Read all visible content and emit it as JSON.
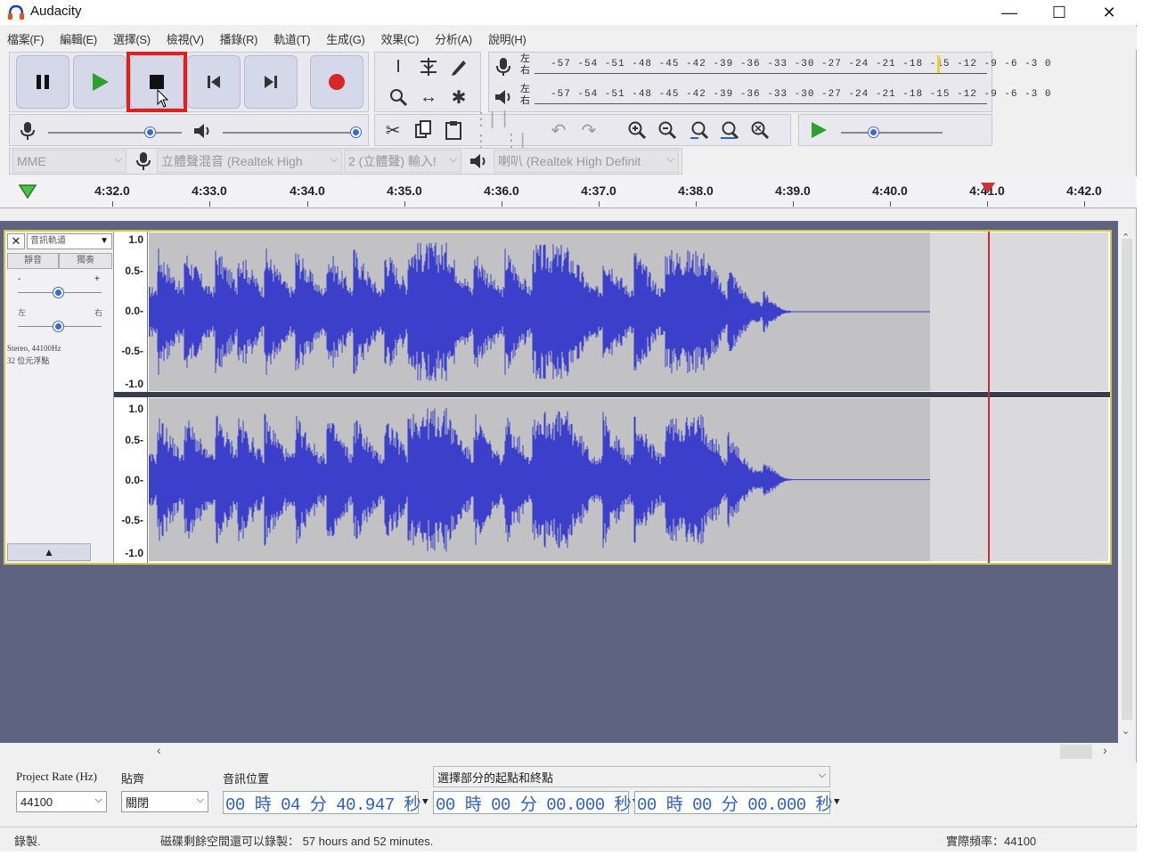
{
  "window": {
    "title": "Audacity",
    "minimize": "—",
    "maximize": "☐",
    "close": "✕"
  },
  "menu": [
    "檔案(F)",
    "編輯(E)",
    "選擇(S)",
    "檢視(V)",
    "播錄(R)",
    "軌道(T)",
    "生成(G)",
    "效果(C)",
    "分析(A)",
    "說明(H)"
  ],
  "meters": {
    "record_lr": "左右",
    "play_lr": "左右",
    "scale": "-57 -54 -51 -48 -45 -42 -39 -36 -33 -30 -27 -24 -21 -18 -15 -12 -9 -6 -3 0"
  },
  "devices": {
    "host": "MME",
    "input_device": "立體聲混音 (Realtek High",
    "channels": "2 (立體聲) 輸入!",
    "output_device": "喇叭 (Realtek High Definit"
  },
  "ruler": {
    "ticks": [
      "4:32.0",
      "4:33.0",
      "4:34.0",
      "4:35.0",
      "4:36.0",
      "4:37.0",
      "4:38.0",
      "4:39.0",
      "4:40.0",
      "4:41.0",
      "4:42.0"
    ]
  },
  "track": {
    "name": "音訊軌道",
    "mute": "靜音",
    "solo": "獨奏",
    "gain_minus": "-",
    "gain_plus": "+",
    "pan_left": "左",
    "pan_right": "右",
    "info_line1": "Stereo, 44100Hz",
    "info_line2": "32 位元浮點",
    "scale": [
      "1.0",
      "0.5-",
      "0.0-",
      "-0.5-",
      "-1.0"
    ]
  },
  "selection": {
    "rate_label": "Project Rate (Hz)",
    "rate_value": "44100",
    "snap_label": "貼齊",
    "snap_value": "關閉",
    "audio_pos_label": "音訊位置",
    "audio_pos_value": "00 時 04 分 40.947 秒",
    "sel_label": "選擇部分的起點和終點",
    "sel_start": "00 時 00 分 00.000 秒",
    "sel_end": "00 時 00 分 00.000 秒"
  },
  "status": {
    "state": "錄製.",
    "disk": "磁碟剩餘空間還可以錄製： 57 hours and 52 minutes.",
    "rate": "實際頻率：44100"
  },
  "colors": {
    "waveform": "#3b3fc9",
    "highlight_box": "#e02020",
    "track_border": "#d4c542",
    "playhead": "#c0303a",
    "play_green": "#2ea02e",
    "record_red": "#d62828"
  }
}
